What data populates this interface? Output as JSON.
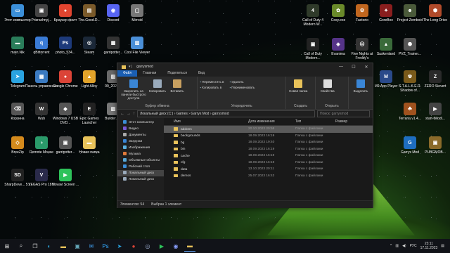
{
  "desktop": {
    "icons": [
      {
        "label": "Этот компьютер",
        "glyph": "▭",
        "color": "#3b8fd8"
      },
      {
        "label": "Prizrachnyj...",
        "glyph": "▣",
        "color": "#444"
      },
      {
        "label": "Браузер фолт",
        "glyph": "●",
        "color": "#e0442f"
      },
      {
        "label": "The.Good.D...",
        "glyph": "▤",
        "color": "#7a5a2a"
      },
      {
        "label": "Discord",
        "glyph": "◉",
        "color": "#5865f2"
      },
      {
        "label": "Mirroid",
        "glyph": "▢",
        "color": "#777"
      },
      {
        "label": "main.Nik",
        "glyph": "▬",
        "color": "#2a7d5a"
      },
      {
        "label": "qBittorrent",
        "glyph": "q",
        "color": "#3a7bd5"
      },
      {
        "label": "photo_534...",
        "glyph": "Ps",
        "color": "#1d3a7a"
      },
      {
        "label": "Steam",
        "glyph": "◎",
        "color": "#1b2838"
      },
      {
        "label": "garripotter...",
        "glyph": "▦",
        "color": "#333"
      },
      {
        "label": "Cool File Viewer",
        "glyph": "▥",
        "color": "#4a8fd8"
      },
      {
        "label": "Telegram",
        "glyph": "➤",
        "color": "#2aa3e0"
      },
      {
        "label": "Панель управления",
        "glyph": "▩",
        "color": "#3b7bc2"
      },
      {
        "label": "Google Chrome",
        "glyph": "●",
        "color": "#db4437"
      },
      {
        "label": "Light Alloy",
        "glyph": "▲",
        "color": "#e2a32a"
      },
      {
        "label": "09_2021...",
        "glyph": "▨",
        "color": "#6a6a6a"
      },
      {
        "label": "Корзина",
        "glyph": "⌫",
        "color": "#555"
      },
      {
        "label": "Wub",
        "glyph": "W",
        "color": "#333"
      },
      {
        "label": "Windows 7 USB DVD...",
        "glyph": "◆",
        "color": "#555"
      },
      {
        "label": "Epic Games Launcher",
        "glyph": "E",
        "color": "#222"
      },
      {
        "label": "Builder.p...",
        "glyph": "▧",
        "color": "#777"
      },
      {
        "label": "BreeZip",
        "glyph": "◇",
        "color": "#d48a1c"
      },
      {
        "label": "Remote Mouse",
        "glyph": "◑",
        "color": "#2a9a6a"
      },
      {
        "label": "garripotter...",
        "glyph": "▣",
        "color": "#555"
      },
      {
        "label": "Новая папка",
        "glyph": "▬",
        "color": "#e8c25a"
      },
      {
        "label": "SharpDeve... 5.1",
        "glyph": "SD",
        "color": "#222"
      },
      {
        "label": "VEGAS Pro 18.0",
        "glyph": "V",
        "color": "#2a2a4a"
      },
      {
        "label": "Movavi Screen ...",
        "glyph": "▶",
        "color": "#2ec25a"
      },
      {
        "label": "Call of Duty 4 Modern W...",
        "glyph": "4",
        "color": "#2f3a2a"
      },
      {
        "label": "Cosy.exe",
        "glyph": "✿",
        "color": "#6a8a2a"
      },
      {
        "label": "Factorio",
        "glyph": "⚙",
        "color": "#c0661f"
      },
      {
        "label": "GoreBox",
        "glyph": "✦",
        "color": "#8a1e1e"
      },
      {
        "label": "Project Zomboid",
        "glyph": "☻",
        "color": "#4a5a3a"
      },
      {
        "label": "The Long Drive",
        "glyph": "⬢",
        "color": "#b04a2a"
      },
      {
        "label": "Call of Duty Modern...",
        "glyph": "▣",
        "color": "#222"
      },
      {
        "label": "Evanima",
        "glyph": "◈",
        "color": "#553388"
      },
      {
        "label": "Five Nights at Freddy's",
        "glyph": "☹",
        "color": "#333"
      },
      {
        "label": "Suskenland",
        "glyph": "▲",
        "color": "#3a6a3a"
      },
      {
        "label": "PVZ_Trainer...",
        "glyph": "⬣",
        "color": "#555"
      },
      {
        "label": "M9.App Player",
        "glyph": "M",
        "color": "#2a4a8a"
      },
      {
        "label": "S.T.A.L.K.E.R. Shadow of...",
        "glyph": "☢",
        "color": "#7a5a1a"
      },
      {
        "label": "ZERO Sievert",
        "glyph": "Z",
        "color": "#2a2a2a"
      },
      {
        "label": "Terraria.v1.4...",
        "glyph": "☘",
        "color": "#a0521e"
      },
      {
        "label": "start-tModl...",
        "glyph": "▶",
        "color": "#444"
      },
      {
        "label": "Garrys Mod",
        "glyph": "G",
        "color": "#1e6ec0"
      },
      {
        "label": "PUBGMOB...",
        "glyph": "▣",
        "color": "#8a6a2a"
      }
    ]
  },
  "explorer": {
    "title": "garrysmod",
    "tabs": [
      "Файл",
      "Главная",
      "Поделиться",
      "Вид"
    ],
    "ribbon": {
      "clipboard": {
        "pin": "Закрепить на панели быстрого доступа",
        "copy": "Копировать",
        "paste": "Вставить",
        "name": "Буфер обмена"
      },
      "organize": {
        "move_to": "Переместить в",
        "copy_to": "Копировать в",
        "delete": "Удалить",
        "rename": "Переименовать",
        "name": "Упорядочить"
      },
      "new": {
        "new_folder": "Новая папка",
        "name": "Создать"
      },
      "open": {
        "properties": "Свойства",
        "name": "Открыть"
      },
      "select": {
        "select": "Выделить"
      }
    },
    "address": {
      "path": "Локальный диск (C:)  ›  Games  ›  Garrys Mod  ›  garrysmod",
      "search_placeholder": "Поиск: garrysmod"
    },
    "nav": [
      "Этот компьютер",
      "Видео",
      "Документы",
      "Загрузки",
      "Изображения",
      "Музыка",
      "Объемные объекты",
      "Рабочий стол",
      "Локальный диск",
      "Локальный диск"
    ],
    "columns": [
      "Имя",
      "Дата изменения",
      "Тип",
      "Размер"
    ],
    "files": [
      {
        "name": "addons",
        "date": "20.10.2023 20:58",
        "type": "Папка с файлами",
        "selected": true
      },
      {
        "name": "backgrounds",
        "date": "18.09.2023 16:19",
        "type": "Папка с файлами"
      },
      {
        "name": "bg",
        "date": "18.09.2023 19:40",
        "type": "Папка с файлами"
      },
      {
        "name": "bin",
        "date": "18.09.2023 16:19",
        "type": "Папка с файлами"
      },
      {
        "name": "cache",
        "date": "18.09.2023 16:19",
        "type": "Папка с файлами"
      },
      {
        "name": "cfg",
        "date": "18.09.2023 16:19",
        "type": "Папка с файлами"
      },
      {
        "name": "data",
        "date": "13.10.2023 20:11",
        "type": "Папка с файлами"
      },
      {
        "name": "demos",
        "date": "25.07.2023 16:43",
        "type": "Папка с файлами"
      }
    ],
    "status": {
      "count": "Элементов: 54",
      "selected": "Выбран 1 элемент"
    }
  },
  "taskbar": {
    "lang": "РУС",
    "time": "23:11",
    "date": "17.11.2023"
  }
}
